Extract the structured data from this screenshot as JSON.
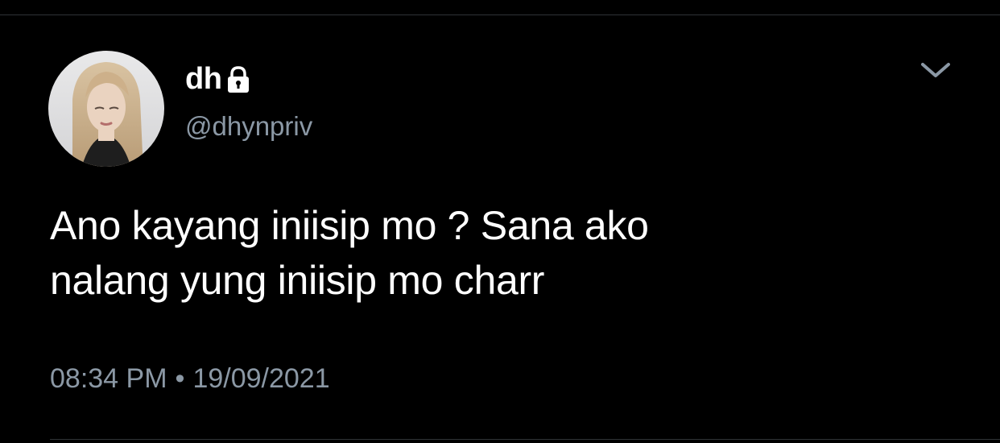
{
  "tweet": {
    "author": {
      "display_name": "dh",
      "handle": "@dhynpriv",
      "protected_icon": "lock-icon",
      "avatar_icon": "profile-photo"
    },
    "text_lines": [
      "Ano kayang iniisip mo ? Sana ako",
      "nalang yung iniisip mo charr"
    ],
    "time": "08:34 PM",
    "separator": "•",
    "date": "19/09/2021",
    "menu_icon": "chevron-down-icon"
  },
  "colors": {
    "background": "#000000",
    "primary_text": "#ffffff",
    "secondary_text": "#8b98a5",
    "divider": "#2f3336"
  }
}
